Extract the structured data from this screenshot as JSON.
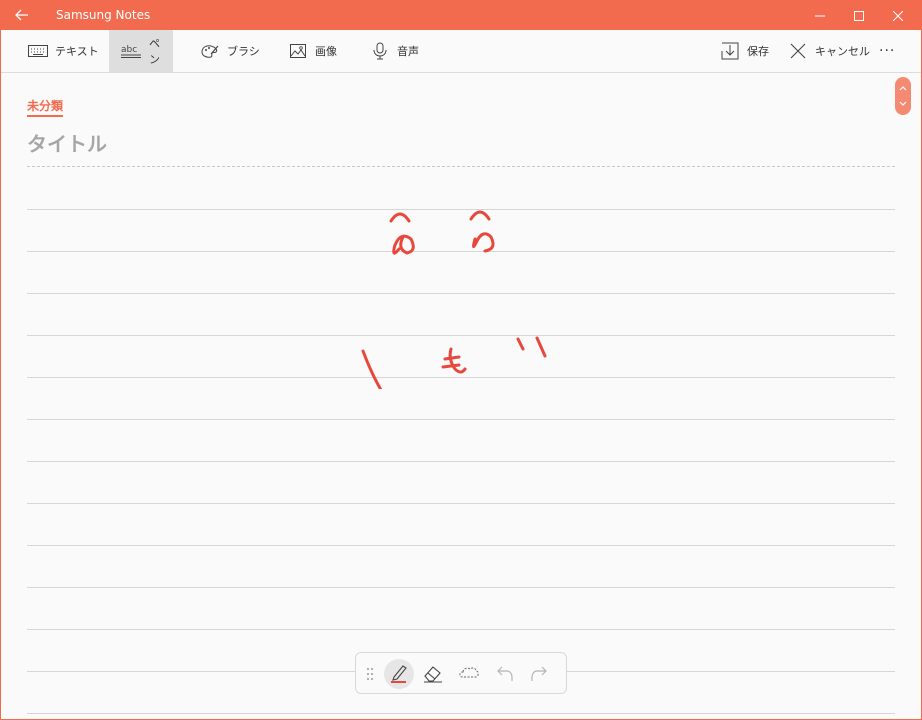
{
  "window": {
    "title": "Samsung Notes",
    "accent_color": "#f36b4f",
    "controls": [
      "minimize-icon",
      "maximize-icon",
      "close-icon"
    ]
  },
  "toolbar": {
    "left_tools": [
      {
        "icon": "keyboard-icon",
        "label": "テキスト"
      },
      {
        "icon": "pen-abc-icon",
        "label": "ペン",
        "active": true
      },
      {
        "icon": "brush-palette-icon",
        "label": "ブラシ"
      },
      {
        "icon": "image-icon",
        "label": "画像"
      },
      {
        "icon": "microphone-icon",
        "label": "音声"
      }
    ],
    "right_tools": [
      {
        "icon": "save-download-icon",
        "label": "保存"
      },
      {
        "icon": "cancel-x-icon",
        "label": "キャンセル"
      }
    ],
    "more_label": "···"
  },
  "note": {
    "category": "未分類",
    "title_placeholder": "タイトル",
    "ink_color": "#e8473b"
  },
  "pen_toolbar": {
    "tools": [
      "drag-handle-icon",
      "pen-icon",
      "eraser-icon",
      "lasso-select-icon",
      "undo-icon",
      "redo-icon"
    ],
    "selected": "pen-icon"
  }
}
